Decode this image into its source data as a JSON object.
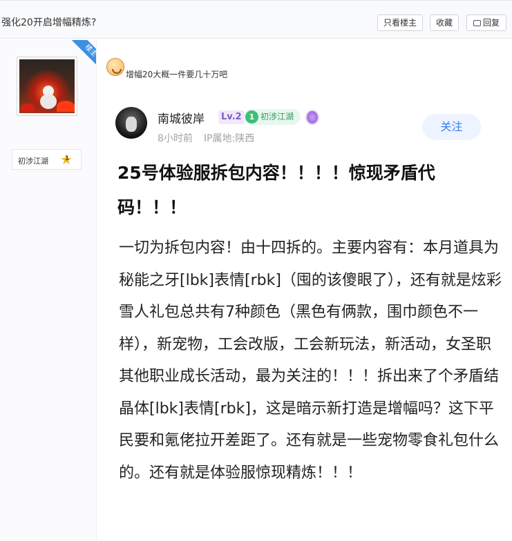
{
  "topbar": {
    "title": "强化20开启增幅精炼?",
    "buttons": {
      "only_op": "只看楼主",
      "favorite": "收藏",
      "reply": "回复"
    }
  },
  "sidebar": {
    "ribbon": "楼主",
    "level_name": "初涉江湖",
    "level_num": "1"
  },
  "reply_text": "增幅20大概一件要几十万吧",
  "embedded_post": {
    "author": "南城彼岸",
    "level": "Lv.2",
    "rank_badge": "初涉江湖",
    "rank_icon_text": "1",
    "time": "8小时前",
    "ip": "IP属地:陕西",
    "follow_label": "关注",
    "title": "25号体验服拆包内容！！！！惊现矛盾代码！！！",
    "body": "一切为拆包内容！由十四拆的。主要内容有：本月道具为秘能之牙[lbk]表情[rbk]（囤的该傻眼了），还有就是炫彩雪人礼包总共有7种颜色（黑色有俩款，围巾颜色不一样），新宠物，工会改版，工会新玩法，新活动，女圣职其他职业成长活动，最为关注的！！！拆出来了个矛盾结晶体[lbk]表情[rbk]，这是暗示新打造是增幅吗？这下平民要和氪佬拉开差距了。还有就是一些宠物零食礼包什么的。还有就是体验服惊现精炼！！！"
  },
  "colors": {
    "accent_blue": "#3b7bea",
    "badge_green": "#3cbf78",
    "level_purple": "#7c5cc4"
  }
}
